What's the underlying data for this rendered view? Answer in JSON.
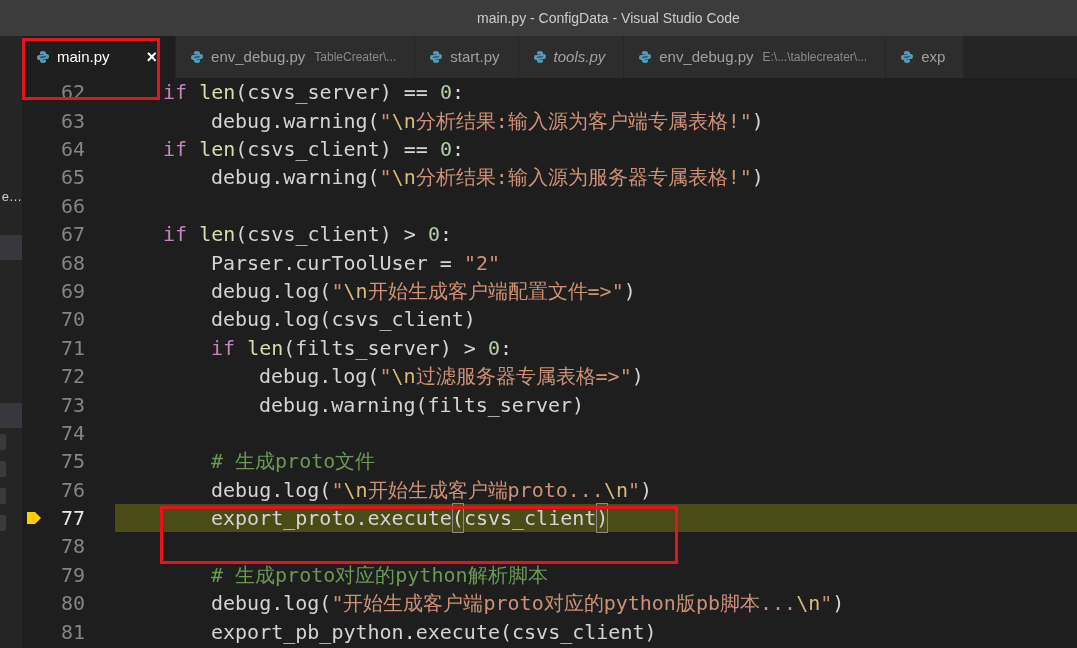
{
  "window": {
    "title": "main.py - ConfigData - Visual Studio Code"
  },
  "sidebar": {
    "items": [
      {
        "label": "e…",
        "selected": false
      },
      {
        "selected": true
      },
      {
        "selected": true
      }
    ]
  },
  "tabs": [
    {
      "name": "main.py",
      "selected": true,
      "preview": false,
      "close": "×"
    },
    {
      "name": "env_debug.py",
      "path": "TableCreater\\...",
      "selected": false,
      "preview": false
    },
    {
      "name": "start.py",
      "selected": false,
      "preview": false
    },
    {
      "name": "tools.py",
      "selected": false,
      "preview": true
    },
    {
      "name": "env_debug.py",
      "path": "E:\\...\\tablecreater\\...",
      "selected": false,
      "preview": false
    },
    {
      "name": "exp",
      "selected": false,
      "preview": false
    }
  ],
  "editor": {
    "lines": [
      {
        "number": "62",
        "current": false,
        "tokens": [
          {
            "kind": "keyword",
            "text": "if "
          },
          {
            "kind": "function",
            "text": "len"
          },
          {
            "kind": "plain",
            "text": "(csvs_server) == "
          },
          {
            "kind": "number",
            "text": "0"
          },
          {
            "kind": "plain",
            "text": ":"
          }
        ],
        "children": [
          {
            "number": "63",
            "current": false,
            "tokens": [
              {
                "kind": "plain",
                "text": "debug.warning("
              },
              {
                "kind": "string",
                "text": "\""
              },
              {
                "kind": "escape",
                "text": "\\n"
              },
              {
                "kind": "string",
                "text": "分析结果:输入源为客户端专属表格!\""
              },
              {
                "kind": "plain",
                "text": ")"
              }
            ]
          }
        ]
      },
      {
        "number": "64",
        "current": false,
        "tokens": [
          {
            "kind": "keyword",
            "text": "if "
          },
          {
            "kind": "function",
            "text": "len"
          },
          {
            "kind": "plain",
            "text": "(csvs_client) == "
          },
          {
            "kind": "number",
            "text": "0"
          },
          {
            "kind": "plain",
            "text": ":"
          }
        ],
        "children": [
          {
            "number": "65",
            "current": false,
            "tokens": [
              {
                "kind": "plain",
                "text": "debug.warning("
              },
              {
                "kind": "string",
                "text": "\""
              },
              {
                "kind": "escape",
                "text": "\\n"
              },
              {
                "kind": "string",
                "text": "分析结果:输入源为服务器专属表格!\""
              },
              {
                "kind": "plain",
                "text": ")"
              }
            ]
          }
        ]
      },
      {
        "number": "66",
        "current": false
      },
      {
        "number": "67",
        "current": false,
        "tokens": [
          {
            "kind": "keyword",
            "text": "if "
          },
          {
            "kind": "function",
            "text": "len"
          },
          {
            "kind": "plain",
            "text": "(csvs_client) > "
          },
          {
            "kind": "number",
            "text": "0"
          },
          {
            "kind": "plain",
            "text": ":"
          }
        ],
        "children": [
          {
            "number": "68",
            "current": false,
            "tokens": [
              {
                "kind": "plain",
                "text": "Parser.curToolUser = "
              },
              {
                "kind": "string",
                "text": "\"2\""
              }
            ]
          },
          {
            "number": "69",
            "current": false,
            "tokens": [
              {
                "kind": "plain",
                "text": "debug.log("
              },
              {
                "kind": "string",
                "text": "\""
              },
              {
                "kind": "escape",
                "text": "\\n"
              },
              {
                "kind": "string",
                "text": "开始生成客户端配置文件=>\""
              },
              {
                "kind": "plain",
                "text": ")"
              }
            ]
          },
          {
            "number": "70",
            "current": false,
            "tokens": [
              {
                "kind": "plain",
                "text": "debug.log(csvs_client)"
              }
            ]
          },
          {
            "number": "71",
            "current": false,
            "tokens": [
              {
                "kind": "keyword",
                "text": "if "
              },
              {
                "kind": "function",
                "text": "len"
              },
              {
                "kind": "plain",
                "text": "(filts_server) > "
              },
              {
                "kind": "number",
                "text": "0"
              },
              {
                "kind": "plain",
                "text": ":"
              }
            ],
            "children": [
              {
                "number": "72",
                "current": false,
                "tokens": [
                  {
                    "kind": "plain",
                    "text": "debug.log("
                  },
                  {
                    "kind": "string",
                    "text": "\""
                  },
                  {
                    "kind": "escape",
                    "text": "\\n"
                  },
                  {
                    "kind": "string",
                    "text": "过滤服务器专属表格=>\""
                  },
                  {
                    "kind": "plain",
                    "text": ")"
                  }
                ]
              },
              {
                "number": "73",
                "current": false,
                "tokens": [
                  {
                    "kind": "plain",
                    "text": "debug.warning(filts_server)"
                  }
                ]
              }
            ]
          },
          {
            "number": "74",
            "current": false
          },
          {
            "number": "75",
            "current": false,
            "tokens": [
              {
                "kind": "comment",
                "text": "# 生成proto文件"
              }
            ]
          },
          {
            "number": "76",
            "current": false,
            "tokens": [
              {
                "kind": "plain",
                "text": "debug.log("
              },
              {
                "kind": "string",
                "text": "\""
              },
              {
                "kind": "escape",
                "text": "\\n"
              },
              {
                "kind": "string",
                "text": "开始生成客户端proto..."
              },
              {
                "kind": "escape",
                "text": "\\n"
              },
              {
                "kind": "string",
                "text": "\""
              },
              {
                "kind": "plain",
                "text": ")"
              }
            ]
          },
          {
            "number": "77",
            "current": true,
            "tokens": [
              {
                "kind": "plain",
                "text": "export_proto.execute"
              },
              {
                "kind": "bracket",
                "text": "("
              },
              {
                "kind": "plain",
                "text": "csvs_client"
              },
              {
                "kind": "bracket",
                "text": ")"
              }
            ]
          },
          {
            "number": "78",
            "current": false
          },
          {
            "number": "79",
            "current": false,
            "tokens": [
              {
                "kind": "comment",
                "text": "# 生成proto对应的python解析脚本"
              }
            ]
          },
          {
            "number": "80",
            "current": false,
            "tokens": [
              {
                "kind": "plain",
                "text": "debug.log("
              },
              {
                "kind": "string",
                "text": "\"开始生成客户端proto对应的python版pb脚本..."
              },
              {
                "kind": "escape",
                "text": "\\n"
              },
              {
                "kind": "string",
                "text": "\""
              },
              {
                "kind": "plain",
                "text": ")"
              }
            ]
          },
          {
            "number": "81",
            "current": false,
            "tokens": [
              {
                "kind": "plain",
                "text": "export_pb_python.execute(csvs_client)"
              }
            ]
          }
        ]
      }
    ]
  }
}
